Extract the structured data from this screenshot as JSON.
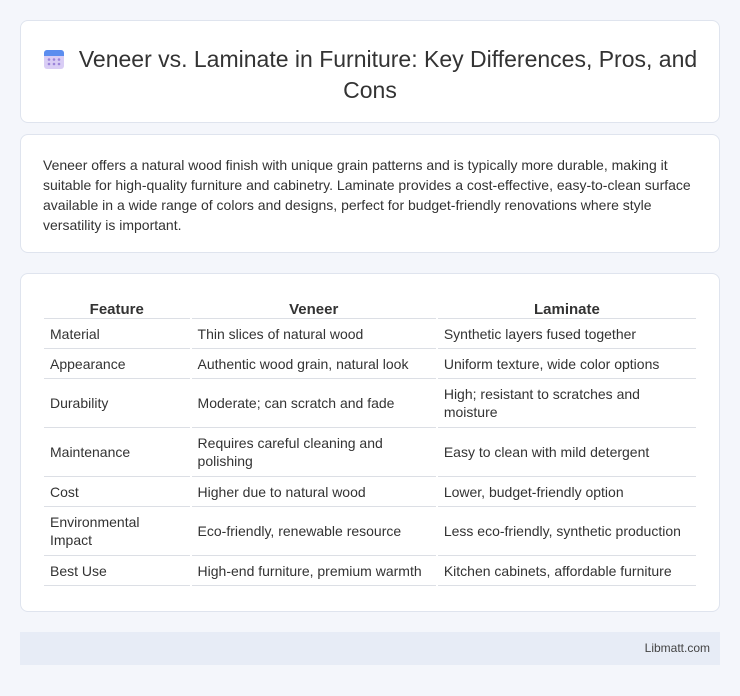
{
  "header": {
    "title": "Veneer vs. Laminate in Furniture: Key Differences, Pros, and Cons",
    "icon": "calendar-icon"
  },
  "summary": {
    "text": "Veneer offers a natural wood finish with unique grain patterns and is typically more durable, making it suitable for high-quality furniture and cabinetry. Laminate provides a cost-effective, easy-to-clean surface available in a wide range of colors and designs, perfect for budget-friendly renovations where style versatility is important."
  },
  "table": {
    "headers": [
      "Feature",
      "Veneer",
      "Laminate"
    ],
    "rows": [
      [
        "Material",
        "Thin slices of natural wood",
        "Synthetic layers fused together"
      ],
      [
        "Appearance",
        "Authentic wood grain, natural look",
        "Uniform texture, wide color options"
      ],
      [
        "Durability",
        "Moderate; can scratch and fade",
        "High; resistant to scratches and moisture"
      ],
      [
        "Maintenance",
        "Requires careful cleaning and polishing",
        "Easy to clean with mild detergent"
      ],
      [
        "Cost",
        "Higher due to natural wood",
        "Lower, budget-friendly option"
      ],
      [
        "Environmental Impact",
        "Eco-friendly, renewable resource",
        "Less eco-friendly, synthetic production"
      ],
      [
        "Best Use",
        "High-end furniture, premium warmth",
        "Kitchen cabinets, affordable furniture"
      ]
    ]
  },
  "footer": {
    "text": "Libmatt.com"
  },
  "colors": {
    "background": "#f4f6fb",
    "card": "#ffffff",
    "footer": "#e7ecf6",
    "icon_top": "#5b8def",
    "icon_body": "#c9b8f0"
  }
}
